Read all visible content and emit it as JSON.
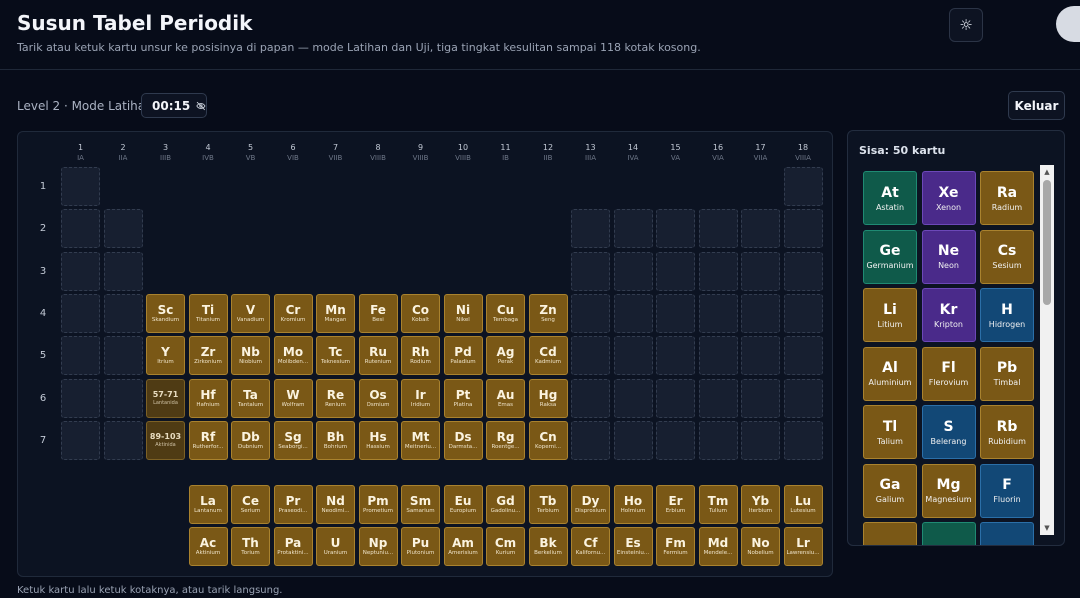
{
  "header": {
    "title": "Susun Tabel Periodik",
    "subtitle": "Tarik atau ketuk kartu unsur ke posisinya di papan — mode Latihan dan Uji, tiga tingkat kesulitan sampai 118 kotak kosong."
  },
  "status": {
    "level_mode": "Level 2 · Mode Latihan",
    "timer": "00:15",
    "exit_label": "Keluar"
  },
  "groups": [
    {
      "n": "1",
      "r": "IA"
    },
    {
      "n": "2",
      "r": "IIA"
    },
    {
      "n": "3",
      "r": "IIIB"
    },
    {
      "n": "4",
      "r": "IVB"
    },
    {
      "n": "5",
      "r": "VB"
    },
    {
      "n": "6",
      "r": "VIB"
    },
    {
      "n": "7",
      "r": "VIIB"
    },
    {
      "n": "8",
      "r": "VIIIB"
    },
    {
      "n": "9",
      "r": "VIIIB"
    },
    {
      "n": "10",
      "r": "VIIIB"
    },
    {
      "n": "11",
      "r": "IB"
    },
    {
      "n": "12",
      "r": "IIB"
    },
    {
      "n": "13",
      "r": "IIIA"
    },
    {
      "n": "14",
      "r": "IVA"
    },
    {
      "n": "15",
      "r": "VA"
    },
    {
      "n": "16",
      "r": "VIA"
    },
    {
      "n": "17",
      "r": "VIIA"
    },
    {
      "n": "18",
      "r": "VIIIA"
    }
  ],
  "periods": [
    "1",
    "2",
    "3",
    "4",
    "5",
    "6",
    "7"
  ],
  "board": {
    "placed": [
      {
        "p": 4,
        "g": 3,
        "sym": "Sc",
        "name": "Skandium"
      },
      {
        "p": 4,
        "g": 4,
        "sym": "Ti",
        "name": "Titanium"
      },
      {
        "p": 4,
        "g": 5,
        "sym": "V",
        "name": "Vanadium"
      },
      {
        "p": 4,
        "g": 6,
        "sym": "Cr",
        "name": "Kromium"
      },
      {
        "p": 4,
        "g": 7,
        "sym": "Mn",
        "name": "Mangan"
      },
      {
        "p": 4,
        "g": 8,
        "sym": "Fe",
        "name": "Besi"
      },
      {
        "p": 4,
        "g": 9,
        "sym": "Co",
        "name": "Kobalt"
      },
      {
        "p": 4,
        "g": 10,
        "sym": "Ni",
        "name": "Nikel"
      },
      {
        "p": 4,
        "g": 11,
        "sym": "Cu",
        "name": "Tembaga"
      },
      {
        "p": 4,
        "g": 12,
        "sym": "Zn",
        "name": "Seng"
      },
      {
        "p": 5,
        "g": 3,
        "sym": "Y",
        "name": "Itrium"
      },
      {
        "p": 5,
        "g": 4,
        "sym": "Zr",
        "name": "Zirkonium"
      },
      {
        "p": 5,
        "g": 5,
        "sym": "Nb",
        "name": "Niobium"
      },
      {
        "p": 5,
        "g": 6,
        "sym": "Mo",
        "name": "Molibden..."
      },
      {
        "p": 5,
        "g": 7,
        "sym": "Tc",
        "name": "Teknesium"
      },
      {
        "p": 5,
        "g": 8,
        "sym": "Ru",
        "name": "Rutenium"
      },
      {
        "p": 5,
        "g": 9,
        "sym": "Rh",
        "name": "Rodium"
      },
      {
        "p": 5,
        "g": 10,
        "sym": "Pd",
        "name": "Paladium"
      },
      {
        "p": 5,
        "g": 11,
        "sym": "Ag",
        "name": "Perak"
      },
      {
        "p": 5,
        "g": 12,
        "sym": "Cd",
        "name": "Kadmium"
      },
      {
        "p": 6,
        "g": 3,
        "sym": "57-71",
        "name": "Lantanida",
        "ph": true
      },
      {
        "p": 6,
        "g": 4,
        "sym": "Hf",
        "name": "Hafnium"
      },
      {
        "p": 6,
        "g": 5,
        "sym": "Ta",
        "name": "Tantalum"
      },
      {
        "p": 6,
        "g": 6,
        "sym": "W",
        "name": "Wolfram"
      },
      {
        "p": 6,
        "g": 7,
        "sym": "Re",
        "name": "Renium"
      },
      {
        "p": 6,
        "g": 8,
        "sym": "Os",
        "name": "Osmium"
      },
      {
        "p": 6,
        "g": 9,
        "sym": "Ir",
        "name": "Iridium"
      },
      {
        "p": 6,
        "g": 10,
        "sym": "Pt",
        "name": "Platina"
      },
      {
        "p": 6,
        "g": 11,
        "sym": "Au",
        "name": "Emas"
      },
      {
        "p": 6,
        "g": 12,
        "sym": "Hg",
        "name": "Raksa"
      },
      {
        "p": 7,
        "g": 3,
        "sym": "89-103",
        "name": "Aktinida",
        "ph": true
      },
      {
        "p": 7,
        "g": 4,
        "sym": "Rf",
        "name": "Rutherfor..."
      },
      {
        "p": 7,
        "g": 5,
        "sym": "Db",
        "name": "Dubnium"
      },
      {
        "p": 7,
        "g": 6,
        "sym": "Sg",
        "name": "Seaborgi..."
      },
      {
        "p": 7,
        "g": 7,
        "sym": "Bh",
        "name": "Bohrium"
      },
      {
        "p": 7,
        "g": 8,
        "sym": "Hs",
        "name": "Hassium"
      },
      {
        "p": 7,
        "g": 9,
        "sym": "Mt",
        "name": "Meitneriu..."
      },
      {
        "p": 7,
        "g": 10,
        "sym": "Ds",
        "name": "Darmsta..."
      },
      {
        "p": 7,
        "g": 11,
        "sym": "Rg",
        "name": "Roentge..."
      },
      {
        "p": 7,
        "g": 12,
        "sym": "Cn",
        "name": "Koperni..."
      }
    ],
    "lanthanides": [
      {
        "sym": "La",
        "name": "Lantanum"
      },
      {
        "sym": "Ce",
        "name": "Serium"
      },
      {
        "sym": "Pr",
        "name": "Praseodi..."
      },
      {
        "sym": "Nd",
        "name": "Neodimi..."
      },
      {
        "sym": "Pm",
        "name": "Prometium"
      },
      {
        "sym": "Sm",
        "name": "Samarium"
      },
      {
        "sym": "Eu",
        "name": "Europium"
      },
      {
        "sym": "Gd",
        "name": "Gadolinu..."
      },
      {
        "sym": "Tb",
        "name": "Terbium"
      },
      {
        "sym": "Dy",
        "name": "Disprosium"
      },
      {
        "sym": "Ho",
        "name": "Holmium"
      },
      {
        "sym": "Er",
        "name": "Erbium"
      },
      {
        "sym": "Tm",
        "name": "Tulium"
      },
      {
        "sym": "Yb",
        "name": "Iterbium"
      },
      {
        "sym": "Lu",
        "name": "Lutesium"
      }
    ],
    "actinides": [
      {
        "sym": "Ac",
        "name": "Aktinium"
      },
      {
        "sym": "Th",
        "name": "Torium"
      },
      {
        "sym": "Pa",
        "name": "Protaktini..."
      },
      {
        "sym": "U",
        "name": "Uranium"
      },
      {
        "sym": "Np",
        "name": "Neptuniu..."
      },
      {
        "sym": "Pu",
        "name": "Plutonium"
      },
      {
        "sym": "Am",
        "name": "Amerisium"
      },
      {
        "sym": "Cm",
        "name": "Kurium"
      },
      {
        "sym": "Bk",
        "name": "Berkelium"
      },
      {
        "sym": "Cf",
        "name": "Kalifornu..."
      },
      {
        "sym": "Es",
        "name": "Einsteiniu..."
      },
      {
        "sym": "Fm",
        "name": "Fermium"
      },
      {
        "sym": "Md",
        "name": "Mendele..."
      },
      {
        "sym": "No",
        "name": "Nobelium"
      },
      {
        "sym": "Lr",
        "name": "Lawrensiu..."
      }
    ]
  },
  "tray": {
    "title": "Sisa: 50 kartu",
    "cards": [
      {
        "sym": "At",
        "name": "Astatin",
        "color": "teal"
      },
      {
        "sym": "Xe",
        "name": "Xenon",
        "color": "purple"
      },
      {
        "sym": "Ra",
        "name": "Radium",
        "color": "gold"
      },
      {
        "sym": "Ge",
        "name": "Germanium",
        "color": "teal"
      },
      {
        "sym": "Ne",
        "name": "Neon",
        "color": "purple"
      },
      {
        "sym": "Cs",
        "name": "Sesium",
        "color": "gold"
      },
      {
        "sym": "Li",
        "name": "Litium",
        "color": "gold"
      },
      {
        "sym": "Kr",
        "name": "Kripton",
        "color": "purple"
      },
      {
        "sym": "H",
        "name": "Hidrogen",
        "color": "blue"
      },
      {
        "sym": "Al",
        "name": "Aluminium",
        "color": "gold"
      },
      {
        "sym": "Fl",
        "name": "Flerovium",
        "color": "gold"
      },
      {
        "sym": "Pb",
        "name": "Timbal",
        "color": "gold"
      },
      {
        "sym": "Tl",
        "name": "Talium",
        "color": "gold"
      },
      {
        "sym": "S",
        "name": "Belerang",
        "color": "blue"
      },
      {
        "sym": "Rb",
        "name": "Rubidium",
        "color": "gold"
      },
      {
        "sym": "Ga",
        "name": "Galium",
        "color": "gold"
      },
      {
        "sym": "Mg",
        "name": "Magnesium",
        "color": "gold"
      },
      {
        "sym": "F",
        "name": "Fluorin",
        "color": "blue"
      },
      {
        "sym": "",
        "name": "",
        "color": "gold"
      },
      {
        "sym": "",
        "name": "",
        "color": "teal"
      },
      {
        "sym": "",
        "name": "",
        "color": "blue"
      }
    ]
  },
  "footer": {
    "hint": "Ketuk kartu lalu ketuk kotaknya, atau tarik langsung."
  }
}
